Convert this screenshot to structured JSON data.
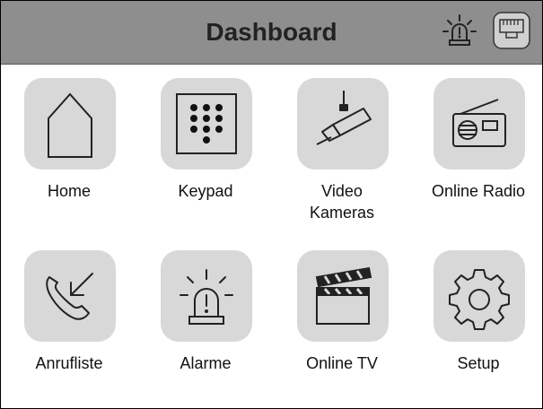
{
  "header": {
    "title": "Dashboard",
    "alarm_icon": "alarm-siren-icon",
    "network_icon": "ethernet-port-icon",
    "background_color": "#8e8e8e"
  },
  "tiles": [
    {
      "label": "Home",
      "icon": "house-icon"
    },
    {
      "label": "Keypad",
      "icon": "keypad-icon"
    },
    {
      "label": "Video\nKameras",
      "icon": "security-camera-icon"
    },
    {
      "label": "Online Radio",
      "icon": "radio-icon"
    },
    {
      "label": "Anrufliste",
      "icon": "phone-incoming-icon"
    },
    {
      "label": "Alarme",
      "icon": "alarm-siren-icon"
    },
    {
      "label": "Online TV",
      "icon": "clapperboard-icon"
    },
    {
      "label": "Setup",
      "icon": "gear-icon"
    }
  ]
}
